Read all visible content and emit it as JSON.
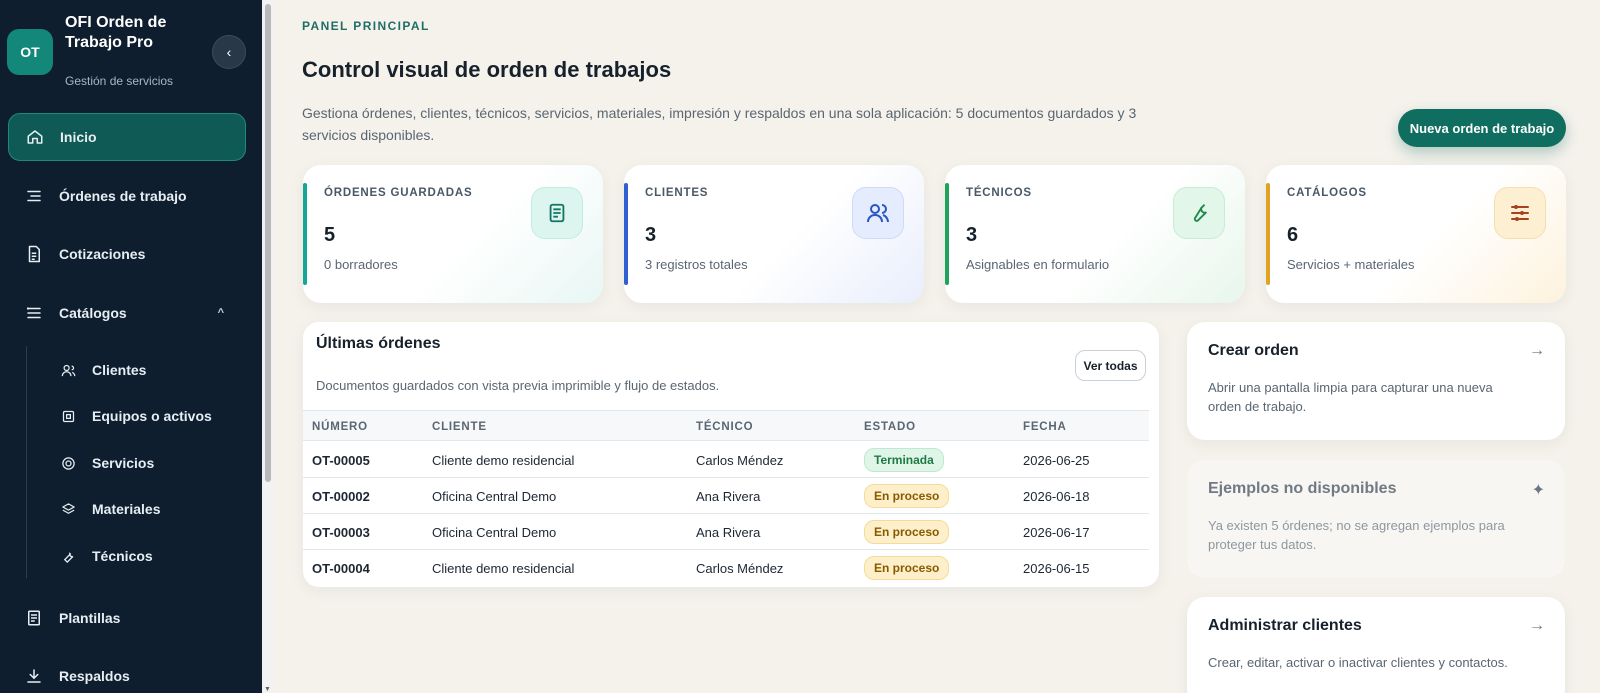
{
  "sidebar": {
    "logo": "OT",
    "app_name": "OFI Orden de Trabajo Pro",
    "app_subtitle": "Gestión de servicios",
    "collapse_icon": "‹",
    "items": [
      {
        "label": "Inicio",
        "icon": "home-icon"
      },
      {
        "label": "Órdenes de trabajo",
        "icon": "list-icon"
      },
      {
        "label": "Cotizaciones",
        "icon": "invoice-icon"
      },
      {
        "label": "Catálogos",
        "icon": "menu-lines-icon",
        "caret": "^"
      },
      {
        "label": "Plantillas",
        "icon": "template-icon"
      },
      {
        "label": "Respaldos",
        "icon": "download-icon"
      }
    ],
    "subitems": [
      {
        "label": "Clientes",
        "icon": "users-icon"
      },
      {
        "label": "Equipos o activos",
        "icon": "device-icon"
      },
      {
        "label": "Servicios",
        "icon": "target-icon"
      },
      {
        "label": "Materiales",
        "icon": "layers-icon"
      },
      {
        "label": "Técnicos",
        "icon": "wrench-icon"
      }
    ]
  },
  "header": {
    "eyebrow": "PANEL PRINCIPAL",
    "title": "Control visual de orden de trabajos",
    "description": "Gestiona órdenes, clientes, técnicos, servicios, materiales, impresión y respaldos en una sola aplicación: 5 documentos guardados y 3 servicios disponibles.",
    "new_order_label": "Nueva orden de trabajo"
  },
  "stats": [
    {
      "label": "ÓRDENES GUARDADAS",
      "value": "5",
      "sub": "0 borradores",
      "accent": "#17a595",
      "icon": "document-icon"
    },
    {
      "label": "CLIENTES",
      "value": "3",
      "sub": "3 registros totales",
      "accent": "#2f5fd0",
      "icon": "users-icon"
    },
    {
      "label": "TÉCNICOS",
      "value": "3",
      "sub": "Asignables en formulario",
      "accent": "#1fa35a",
      "icon": "wrench-icon"
    },
    {
      "label": "CATÁLOGOS",
      "value": "6",
      "sub": "Servicios + materiales",
      "accent": "#e0a224",
      "icon": "list-icon"
    }
  ],
  "orders": {
    "title": "Últimas órdenes",
    "description": "Documentos guardados con vista previa imprimible y flujo de estados.",
    "view_all_label": "Ver todas",
    "columns": [
      "NÚMERO",
      "CLIENTE",
      "TÉCNICO",
      "ESTADO",
      "FECHA"
    ],
    "rows": [
      {
        "numero": "OT-00005",
        "cliente": "Cliente demo residencial",
        "tecnico": "Carlos Méndez",
        "estado": "Terminada",
        "fecha": "2026-06-25"
      },
      {
        "numero": "OT-00002",
        "cliente": "Oficina Central Demo",
        "tecnico": "Ana Rivera",
        "estado": "En proceso",
        "fecha": "2026-06-18"
      },
      {
        "numero": "OT-00003",
        "cliente": "Oficina Central Demo",
        "tecnico": "Ana Rivera",
        "estado": "En proceso",
        "fecha": "2026-06-17"
      },
      {
        "numero": "OT-00004",
        "cliente": "Cliente demo residencial",
        "tecnico": "Carlos Méndez",
        "estado": "En proceso",
        "fecha": "2026-06-15"
      }
    ]
  },
  "quick_actions": [
    {
      "title": "Crear orden",
      "description": "Abrir una pantalla limpia para capturar una nueva orden de trabajo.",
      "icon": "→"
    },
    {
      "title": "Ejemplos no disponibles",
      "description": "Ya existen 5 órdenes; no se agregan ejemplos para proteger tus datos.",
      "icon": "✦"
    },
    {
      "title": "Administrar clientes",
      "description": "Crear, editar, activar o inactivar clientes y contactos.",
      "icon": "→"
    }
  ],
  "colors": {
    "sidebar_bg": "#0f1e2e",
    "accent": "#0f6e60",
    "status_done": "#1f7a46",
    "status_progress": "#8a5a00"
  }
}
